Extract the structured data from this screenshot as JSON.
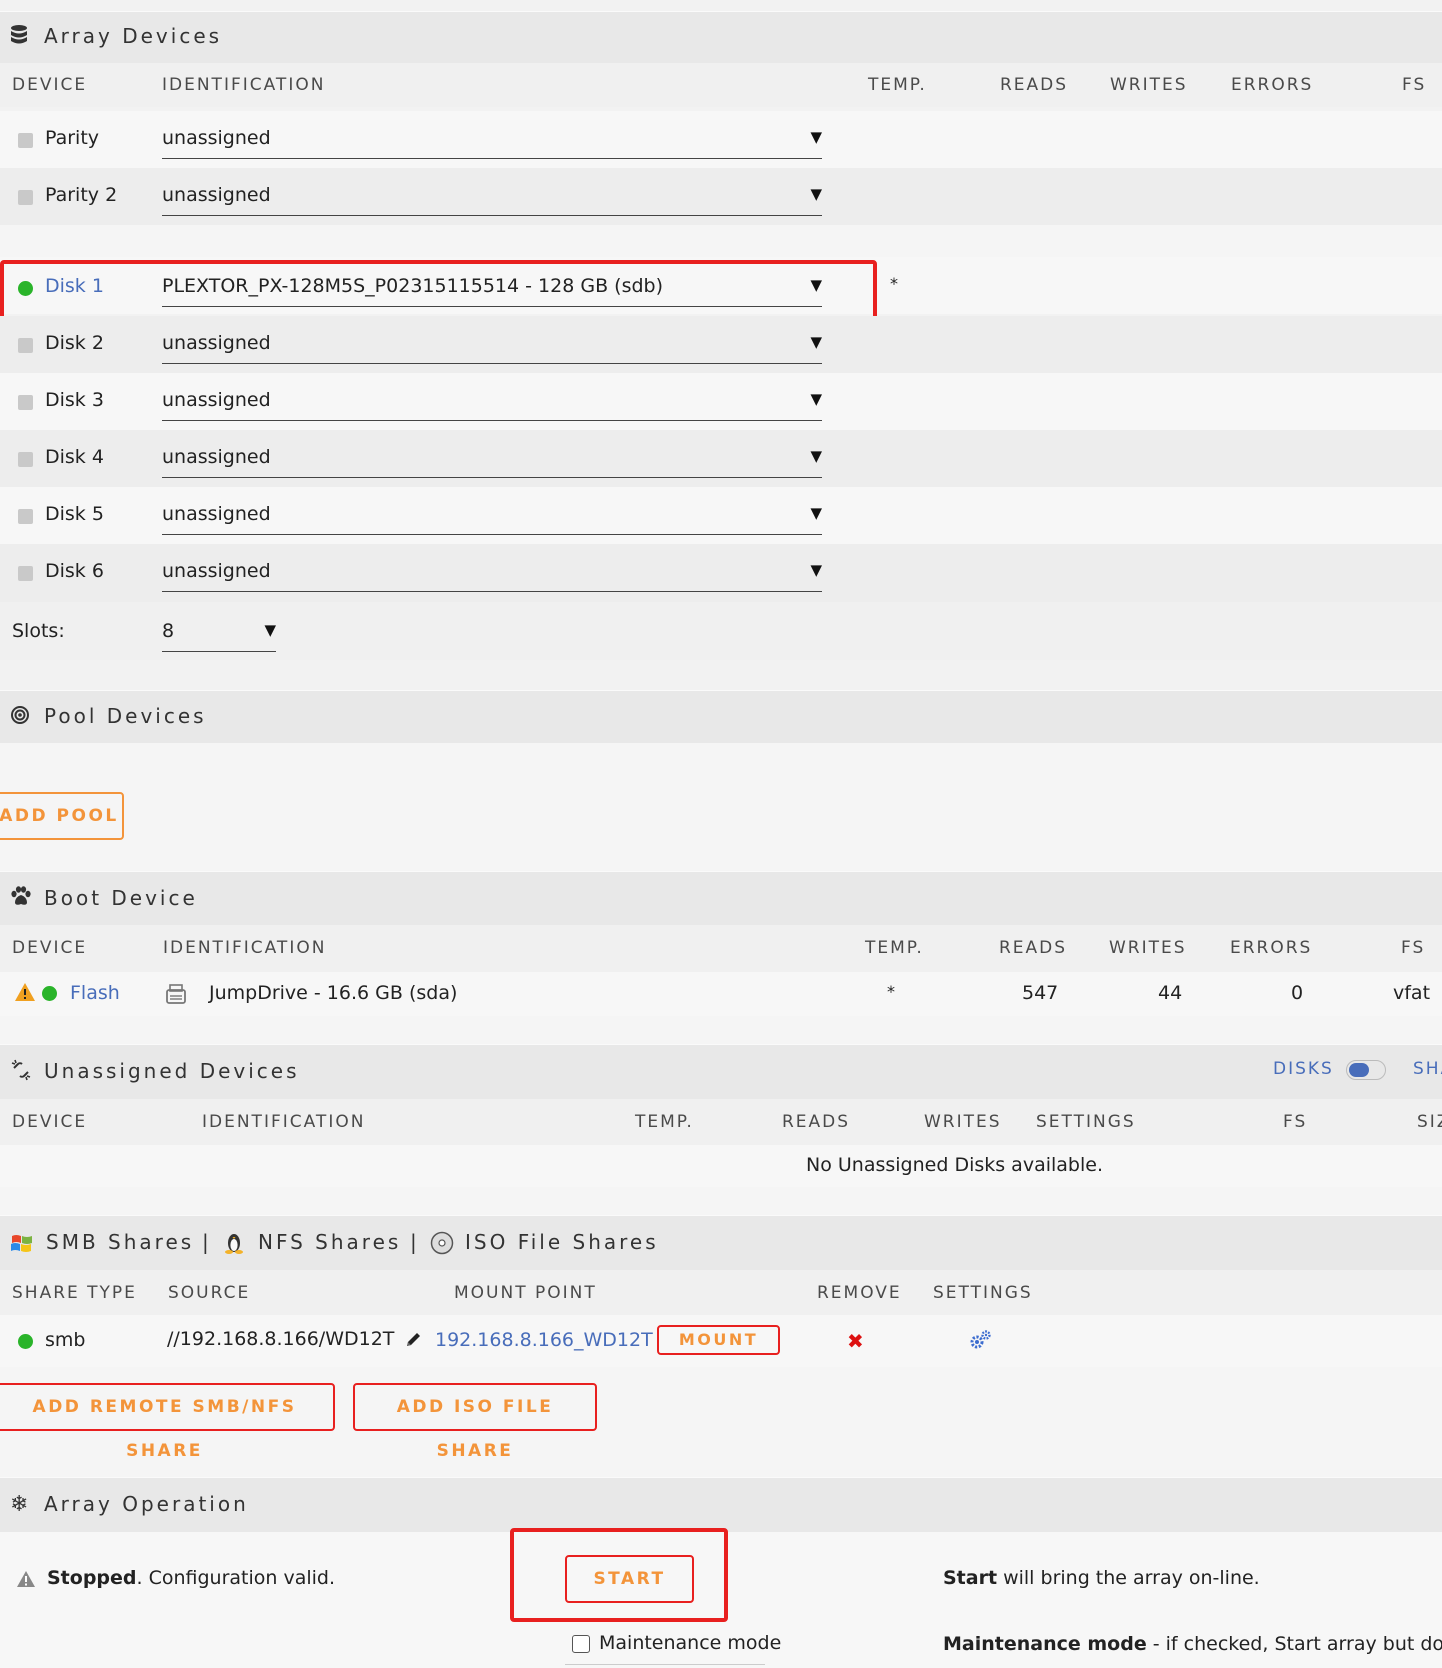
{
  "array": {
    "title": "Array Devices",
    "columns": [
      "DEVICE",
      "IDENTIFICATION",
      "TEMP.",
      "READS",
      "WRITES",
      "ERRORS",
      "FS"
    ],
    "parity_rows": [
      {
        "device": "Parity",
        "identification": "unassigned"
      },
      {
        "device": "Parity 2",
        "identification": "unassigned"
      }
    ],
    "disk1": {
      "device": "Disk 1",
      "identification": "PLEXTOR_PX-128M5S_P02315115514 - 128 GB (sdb)",
      "temp": "*"
    },
    "disk_rows": [
      {
        "device": "Disk 2",
        "identification": "unassigned"
      },
      {
        "device": "Disk 3",
        "identification": "unassigned"
      },
      {
        "device": "Disk 4",
        "identification": "unassigned"
      },
      {
        "device": "Disk 5",
        "identification": "unassigned"
      },
      {
        "device": "Disk 6",
        "identification": "unassigned"
      }
    ],
    "slots_label": "Slots:",
    "slots_value": "8"
  },
  "pool": {
    "title": "Pool Devices",
    "add_button": "ADD POOL"
  },
  "boot": {
    "title": "Boot Device",
    "columns": [
      "DEVICE",
      "IDENTIFICATION",
      "TEMP.",
      "READS",
      "WRITES",
      "ERRORS",
      "FS"
    ],
    "row": {
      "device": "Flash",
      "identification": "JumpDrive - 16.6 GB (sda)",
      "temp": "*",
      "reads": "547",
      "writes": "44",
      "errors": "0",
      "fs": "vfat"
    }
  },
  "unassigned": {
    "title": "Unassigned Devices",
    "toggle_label": "DISKS",
    "toggle_label2": "SHA",
    "columns": [
      "DEVICE",
      "IDENTIFICATION",
      "TEMP.",
      "READS",
      "WRITES",
      "SETTINGS",
      "FS",
      "SIZ"
    ],
    "empty_text": "No Unassigned Disks available."
  },
  "shares": {
    "tabs": [
      "SMB Shares",
      "NFS Shares",
      "ISO File Shares"
    ],
    "separator": "|",
    "columns": [
      "SHARE TYPE",
      "SOURCE",
      "MOUNT POINT",
      "REMOVE",
      "SETTINGS"
    ],
    "row": {
      "type": "smb",
      "source": "//192.168.8.166/WD12T",
      "mount_point": "192.168.8.166_WD12T",
      "mount_button": "MOUNT"
    },
    "add_remote_button": "ADD REMOTE SMB/NFS SHARE",
    "add_iso_button": "ADD ISO FILE SHARE"
  },
  "operation": {
    "title": "Array Operation",
    "status_bold": "Stopped",
    "status_rest": ". Configuration valid.",
    "start_button": "START",
    "maintenance_label": "Maintenance mode",
    "start_help_bold": "Start",
    "start_help_rest": " will bring the array on-line.",
    "maint_help_bold": "Maintenance mode",
    "maint_help_rest": " - if checked, Start array but do not m"
  },
  "colors": {
    "accent": "#f3943a",
    "link": "#486dba",
    "ok": "#2ab42a",
    "highlight": "#e8201f"
  }
}
